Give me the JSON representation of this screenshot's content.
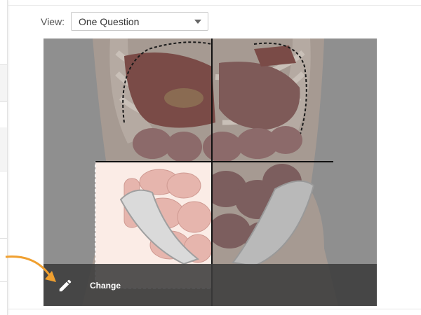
{
  "view": {
    "label": "View:",
    "selected": "One Question"
  },
  "image": {
    "toolbar": {
      "change_label": "Change",
      "icon": "pencil-icon"
    }
  },
  "colors": {
    "accent_arrow": "#f0a030",
    "toolbar_bg": "#3c3c3c"
  }
}
